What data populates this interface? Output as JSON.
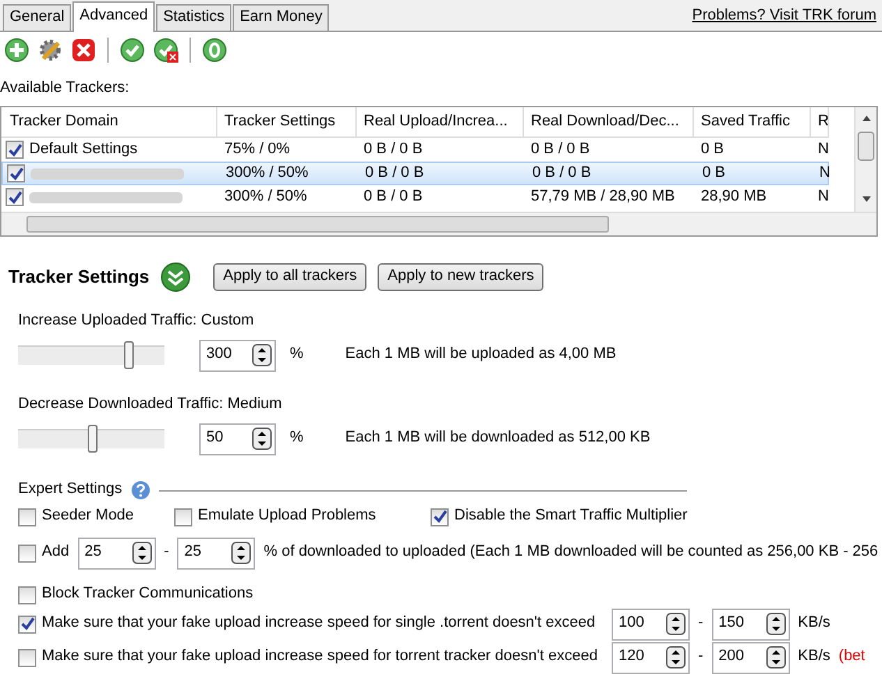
{
  "tabs": [
    {
      "label": "General",
      "selected": false
    },
    {
      "label": "Advanced",
      "selected": true
    },
    {
      "label": "Statistics",
      "selected": false
    },
    {
      "label": "Earn Money",
      "selected": false
    }
  ],
  "forum_link": "Problems? Visit TRK forum",
  "trackers": {
    "label": "Available Trackers:",
    "columns": [
      "Tracker Domain",
      "Tracker Settings",
      "Real Upload/Increa...",
      "Real Download/Dec...",
      "Saved Traffic",
      "R"
    ],
    "rows": [
      {
        "checked": true,
        "selected": false,
        "blurred": false,
        "cells": [
          "Default Settings",
          "75% / 0%",
          "0 B / 0 B",
          "0 B / 0 B",
          "0 B",
          "N"
        ]
      },
      {
        "checked": true,
        "selected": true,
        "blurred": true,
        "cells": [
          "300% / 50%",
          "0 B / 0 B",
          "0 B / 0 B",
          "0 B",
          "N"
        ]
      },
      {
        "checked": true,
        "selected": false,
        "blurred": true,
        "cells": [
          "300% / 50%",
          "0 B / 0 B",
          "57,79 MB / 28,90 MB",
          "28,90 MB",
          "N"
        ]
      }
    ]
  },
  "settings": {
    "title": "Tracker Settings",
    "buttons": [
      "Apply to all trackers",
      "Apply to new trackers"
    ],
    "sliders": [
      {
        "label": "Increase Uploaded Traffic: Custom",
        "level": 0.75,
        "value": "300",
        "unit": "%",
        "note": "Each 1 MB will be uploaded as 4,00 MB"
      },
      {
        "label": "Decrease Downloaded Traffic: Medium",
        "level": 0.5,
        "value": "50",
        "unit": "%",
        "note": "Each 1 MB will be downloaded as 512,00 KB"
      }
    ],
    "expert": {
      "title": "Expert Settings",
      "options": [
        {
          "label": "Seeder Mode",
          "checked": false
        },
        {
          "label": "Emulate Upload Problems",
          "checked": false
        },
        {
          "label": "Disable the Smart Traffic Multiplier",
          "checked": true
        }
      ],
      "add": {
        "label": "Add",
        "checked": false,
        "from": "25",
        "to": "25",
        "separator": "-",
        "note": "% of downloaded to uploaded (Each 1 MB downloaded will be counted as 256,00 KB - 256"
      },
      "block": {
        "label": "Block Tracker Communications",
        "checked": false
      },
      "limits": [
        {
          "label": "Make sure that your fake upload increase speed for single .torrent doesn't exceed",
          "checked": true,
          "from": "100",
          "separator": "-",
          "to": "150",
          "unit": "KB/s"
        },
        {
          "label": "Make sure that your fake upload increase speed for torrent tracker doesn't exceed",
          "checked": false,
          "from": "120",
          "separator": "-",
          "to": "200",
          "unit": "KB/s",
          "warning": "(bet"
        }
      ]
    }
  }
}
